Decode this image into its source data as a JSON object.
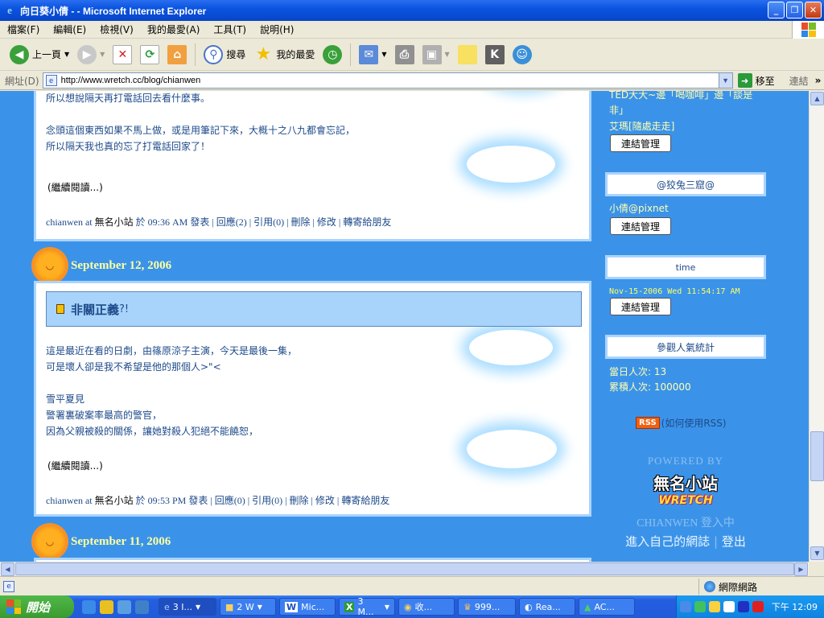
{
  "window": {
    "title": "向日葵小倩 - - Microsoft Internet Explorer",
    "ie_glyph": "e"
  },
  "menu": [
    "檔案(F)",
    "編輯(E)",
    "檢視(V)",
    "我的最愛(A)",
    "工具(T)",
    "說明(H)"
  ],
  "toolbar": {
    "back": "上一頁",
    "search": "搜尋",
    "favorites": "我的最愛"
  },
  "address": {
    "label": "網址(D)",
    "url": "http://www.wretch.cc/blog/chianwen",
    "go": "移至",
    "links": "連結"
  },
  "posts": [
    {
      "body": [
        "所以想說隔天再打電話回去看什麼事。",
        "",
        "念頭這個東西如果不馬上做，或是用筆記下來，大概十之八九都會忘記，",
        "所以隔天我也真的忘了打電話回家了！"
      ],
      "more": "(繼續閱讀...)",
      "meta_author": "chianwen at ",
      "meta_site": "無名小站",
      "meta_rest": " 於 09:36 AM 發表 | 回應(2) | 引用(0) | 刪除 | 修改 | 轉寄給朋友"
    },
    {
      "date": "September 12, 2006",
      "title": "非關正義",
      "title_suffix": "?!",
      "body": [
        "這是最近在看的日劇，由篠原涼子主演，今天是最後一集，",
        "可是壞人卻是我不希望是他的那個人>\"<",
        "",
        "雪平夏見",
        "警署裏破案率最高的警官，",
        "因為父親被殺的關係，讓她對殺人犯絕不能饒恕，"
      ],
      "more": "(繼續閱讀...)",
      "meta_author": "chianwen at ",
      "meta_site": "無名小站",
      "meta_rest": " 於 09:53 PM 發表 | 回應(0) | 引用(0) | 刪除 | 修改 | 轉寄給朋友"
    }
  ],
  "next_date": "September 11, 2006",
  "sidebar": {
    "top_text": [
      "TED大大~邊「喝咖啡」邊「談是",
      "非」"
    ],
    "link1": "艾瑪[隨處走走]",
    "manage": "連結管理",
    "box1": "@狡兔三窟@",
    "link2": "小倩@pixnet",
    "box2": "time",
    "time_value": "Nov-15-2006 Wed 11:54:17 AM",
    "box3": "參觀人氣統計",
    "today": "當日人次: 13",
    "total": "累積人次: 100000",
    "rss_badge": "RSS",
    "rss_text": "(如何使用RSS)",
    "powered": "POWERED BY",
    "logo_top": "無名小站",
    "logo_bottom": "WRETCH",
    "login_status": "CHIANWEN 登入中",
    "enter": "進入自己的網誌",
    "logout": "登出",
    "sep": "|"
  },
  "status": {
    "zone": "網際網路"
  },
  "taskbar": {
    "start": "開始",
    "tasks": [
      "3 I...",
      "2 W",
      "Mic...",
      "3 M...",
      "收...",
      "999...",
      "Rea...",
      "AC..."
    ],
    "clock": "下午 12:09"
  }
}
